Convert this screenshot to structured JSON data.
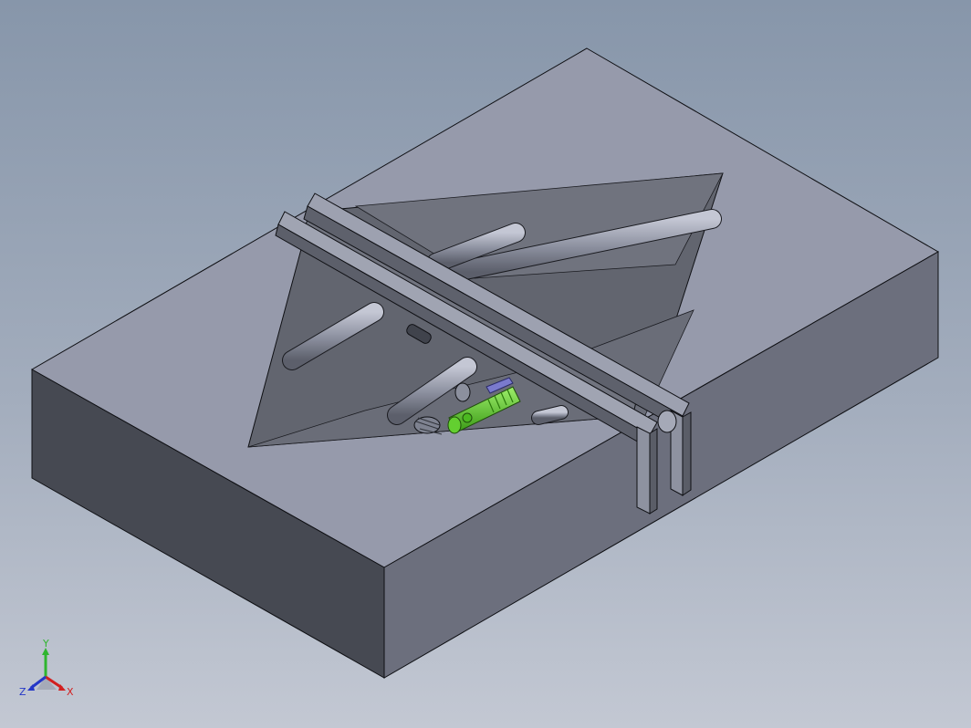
{
  "viewport": {
    "background_top": "#8796aa",
    "background_bottom": "#c3c8d3"
  },
  "model": {
    "top_face_color": "#969aab",
    "left_face_color": "#464952",
    "right_face_color": "#6c6f7d",
    "edge_color": "#0f1014",
    "cavity_color": "#62656f",
    "highlight_part_color": "#5cc42e",
    "accent_part_color": "#7a7acd"
  },
  "triad": {
    "x_label": "X",
    "y_label": "Y",
    "z_label": "Z",
    "x_color": "#d21f1f",
    "y_color": "#2fb52f",
    "z_color": "#2437c7"
  }
}
